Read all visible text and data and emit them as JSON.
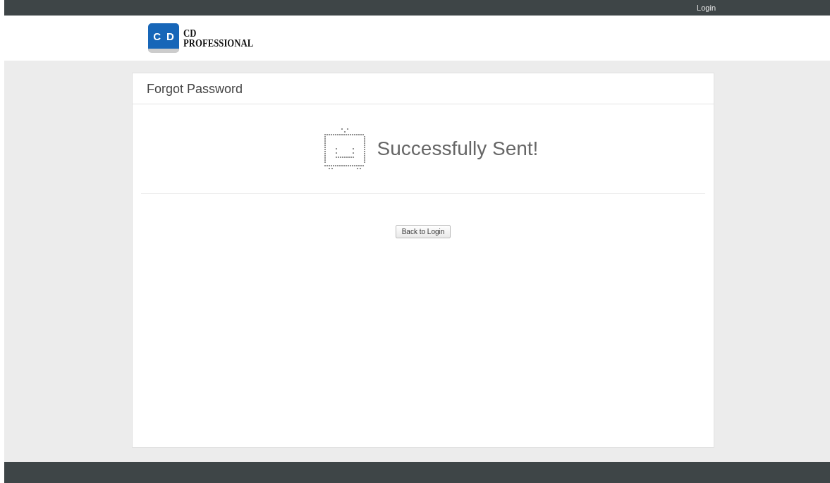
{
  "top_bar": {
    "login_link": "Login"
  },
  "logo": {
    "mark_letters": [
      "C",
      "D"
    ],
    "name_lines": [
      "CD",
      "PROFESSIONAL"
    ]
  },
  "panel": {
    "title": "Forgot Password",
    "message": "Successfully Sent!",
    "button": "Back to Login"
  }
}
